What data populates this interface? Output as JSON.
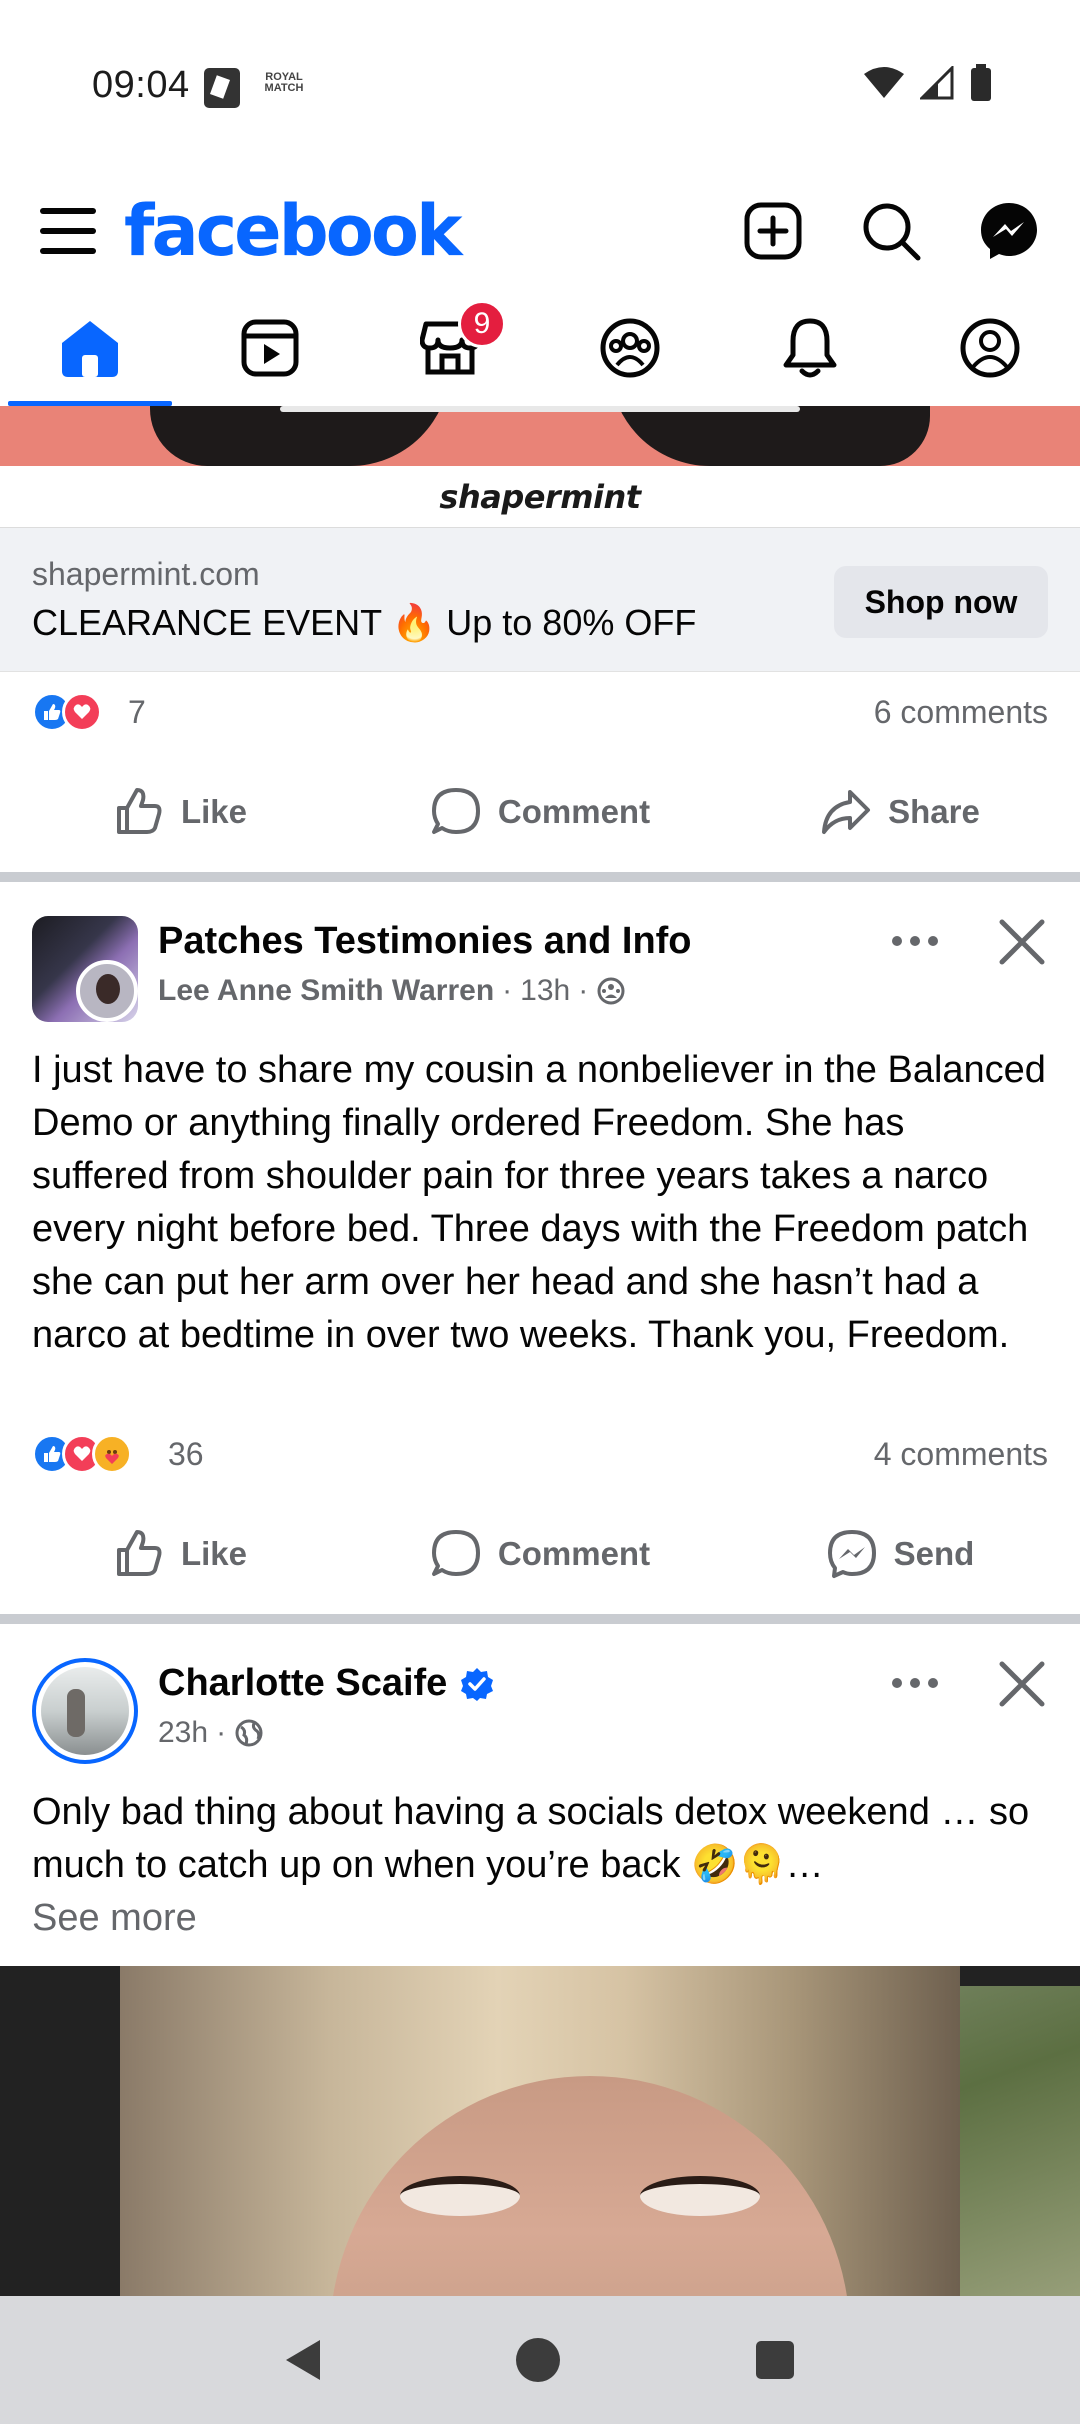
{
  "status_bar": {
    "time": "09:04",
    "app_badge": "ROYAL MATCH"
  },
  "app": {
    "brand": "facebook",
    "brand_color": "#0866ff"
  },
  "nav_tabs": [
    {
      "name": "home",
      "active": true
    },
    {
      "name": "video"
    },
    {
      "name": "marketplace",
      "badge": "9"
    },
    {
      "name": "groups"
    },
    {
      "name": "notifications"
    },
    {
      "name": "profile"
    }
  ],
  "ad_post": {
    "logo_text": "shapermint",
    "domain": "shapermint.com",
    "headline": "CLEARANCE EVENT 🔥 Up to 80% OFF",
    "cta": "Shop now",
    "reaction_count": "7",
    "comments": "6 comments",
    "actions": {
      "like": "Like",
      "comment": "Comment",
      "share": "Share"
    }
  },
  "post1": {
    "group": "Patches Testimonies and Info",
    "author": "Lee Anne Smith Warren",
    "time": "13h",
    "separator": "·",
    "text": "I just have to share my cousin a nonbeliever in the Balanced Demo or anything finally ordered Freedom. She has suffered from shoulder pain for three years takes a narco every night before bed. Three days with the Freedom patch she can put her arm over her head and she hasn’t had a narco at bedtime in over two weeks.  Thank you, Freedom.",
    "reaction_count": "36",
    "comments": "4 comments",
    "actions": {
      "like": "Like",
      "comment": "Comment",
      "send": "Send"
    }
  },
  "post2": {
    "author": "Charlotte Scaife",
    "time": "23h",
    "separator": "·",
    "text": "Only bad thing about having a socials detox weekend … so much to catch up on when you’re back 🤣🫠…",
    "see_more": "See more"
  }
}
